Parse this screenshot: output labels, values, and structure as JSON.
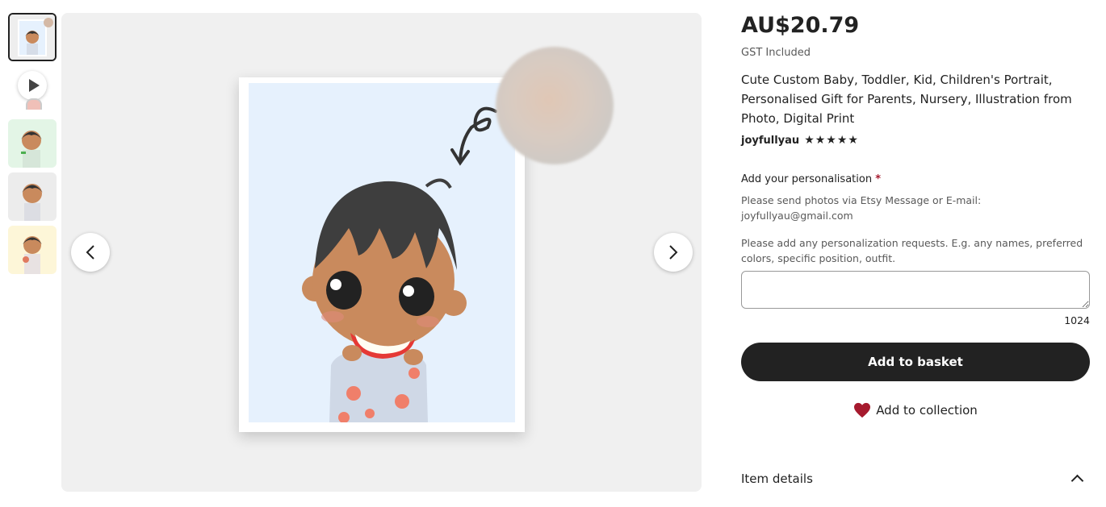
{
  "gallery": {
    "thumbnails": [
      {
        "name": "thumbnail-1",
        "active": true
      },
      {
        "name": "video-thumbnail",
        "icon": "play-icon"
      },
      {
        "name": "thumbnail-3",
        "bg": "#e3f5e6"
      },
      {
        "name": "thumbnail-4",
        "bg": "#ececec"
      },
      {
        "name": "thumbnail-5",
        "bg": "#fdf6d8"
      }
    ],
    "prev_icon": "chevron-left-icon",
    "next_icon": "chevron-right-icon"
  },
  "listing": {
    "price": "AU$20.79",
    "tax_note": "GST Included",
    "title": "Cute Custom Baby, Toddler, Kid, Children's Portrait, Personalised Gift for Parents, Nursery, Illustration from Photo, Digital Print",
    "shop_name": "joyfullyau",
    "rating_stars": "★★★★★",
    "rating": 5
  },
  "personalisation": {
    "label": "Add your personalisation",
    "required_mark": "*",
    "help_line1": "Please send photos via Etsy Message or E-mail:",
    "help_email": "joyfullyau@gmail.com",
    "help_line2": "Please add any personalization requests. E.g. any names, preferred colors, specific position, outfit.",
    "value": "",
    "char_remaining": "1024"
  },
  "actions": {
    "add_to_basket": "Add to basket",
    "add_to_collection": "Add to collection",
    "collection_icon": "heart-icon"
  },
  "details": {
    "label": "Item details",
    "icon": "chevron-up-icon"
  },
  "colors": {
    "button_dark": "#222222",
    "heart": "#a61a2e",
    "frame_bg": "#e6f1fd"
  }
}
